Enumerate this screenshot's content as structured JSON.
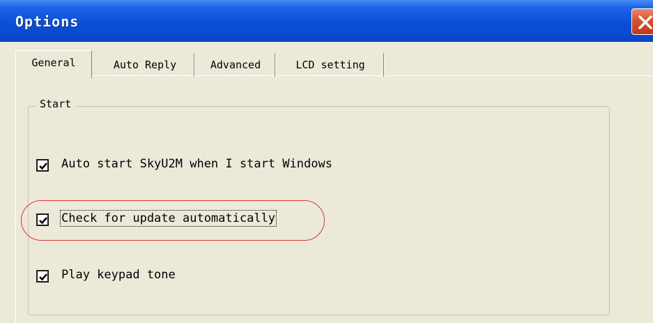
{
  "window": {
    "title": "Options"
  },
  "tabs": [
    {
      "label": "General",
      "active": true
    },
    {
      "label": "Auto Reply",
      "active": false
    },
    {
      "label": "Advanced",
      "active": false
    },
    {
      "label": "LCD setting",
      "active": false
    }
  ],
  "group": {
    "label": "Start"
  },
  "options": [
    {
      "label": "Auto start SkyU2M when I start Windows",
      "checked": true
    },
    {
      "label": "Check for update automatically",
      "checked": true
    },
    {
      "label": "Play keypad tone",
      "checked": true
    }
  ],
  "colors": {
    "titlebar": "#0b4fd8",
    "dialog_background": "#ece9d8",
    "close_button": "#d9502f",
    "highlight_ring": "#d4383a"
  },
  "icons": {
    "close": "close-x-icon",
    "check": "checkmark-icon"
  }
}
